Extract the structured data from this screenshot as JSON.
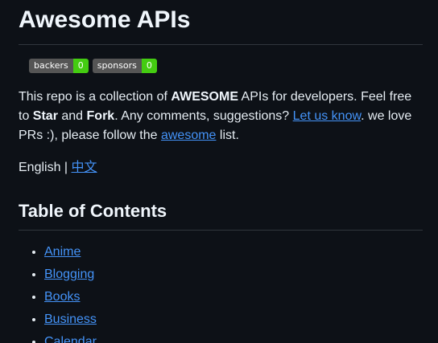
{
  "title": "Awesome APIs",
  "badges": [
    {
      "label": "backers",
      "count": "0"
    },
    {
      "label": "sponsors",
      "count": "0"
    }
  ],
  "intro": {
    "t1": "This repo is a collection of ",
    "b1": "AWESOME",
    "t2": " APIs for developers. Feel free to ",
    "b2": "Star",
    "t3": " and ",
    "b3": "Fork",
    "t4": ". Any comments, suggestions? ",
    "link1": "Let us know",
    "t5": ". we love PRs :), please follow the ",
    "link2": "awesome",
    "t6": " list."
  },
  "language": {
    "current": "English",
    "separator": " | ",
    "other": "中文"
  },
  "toc": {
    "heading": "Table of Contents",
    "items": [
      "Anime",
      "Blogging",
      "Books",
      "Business",
      "Calendar"
    ]
  },
  "colors": {
    "background": "#0d1117",
    "text": "#e6edf3",
    "link": "#4493f8",
    "badge_label": "#555555",
    "badge_count": "#44cc11",
    "divider": "#30363d"
  }
}
